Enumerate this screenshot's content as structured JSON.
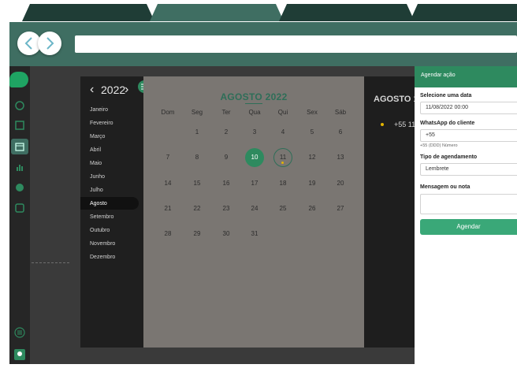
{
  "colors": {
    "brand": "#2e8a5f",
    "toolbar": "#3f6e62",
    "accent_dot": "#e2b400"
  },
  "browser": {
    "nav_back_icon": "chevron-left-icon",
    "nav_forward_icon": "chevron-right-icon"
  },
  "sidebar": {
    "icons": [
      "whatsapp-icon",
      "contacts-icon",
      "calendar-icon",
      "chart-icon",
      "bot-icon",
      "inbox-icon",
      "menu-icon",
      "user-icon"
    ],
    "active": "calendar-icon"
  },
  "calendar": {
    "year": "2022",
    "months": [
      "Janeiro",
      "Fevereiro",
      "Março",
      "Abril",
      "Maio",
      "Junho",
      "Julho",
      "Agosto",
      "Setembro",
      "Outubro",
      "Novembro",
      "Dezembro"
    ],
    "selected_month": "Agosto",
    "title": "AGOSTO 2022",
    "weekdays": [
      "Dom",
      "Seg",
      "Ter",
      "Qua",
      "Qui",
      "Sex",
      "Sáb"
    ],
    "days": [
      "1",
      "2",
      "3",
      "4",
      "5",
      "6",
      "7",
      "8",
      "9",
      "10",
      "11",
      "12",
      "13",
      "14",
      "15",
      "16",
      "17",
      "18",
      "19",
      "20",
      "21",
      "22",
      "23",
      "24",
      "25",
      "26",
      "27",
      "28",
      "29",
      "30",
      "31"
    ],
    "first_weekday": 1,
    "selected_day": "10",
    "today": "11",
    "event_days": [
      "11"
    ]
  },
  "background_panel": {
    "heading": "AGOSTO 1",
    "row_text": "+55 11"
  },
  "form": {
    "header": "Agendar ação",
    "date_label": "Selecione uma data",
    "date_value": "11/08/2022 00:00",
    "whatsapp_label": "WhatsApp do cliente",
    "whatsapp_value": "+55",
    "whatsapp_hint": "+55 (DDD) Número",
    "type_label": "Tipo de agendamento",
    "type_value": "Lembrete",
    "message_label": "Mensagem ou nota",
    "submit_label": "Agendar"
  }
}
